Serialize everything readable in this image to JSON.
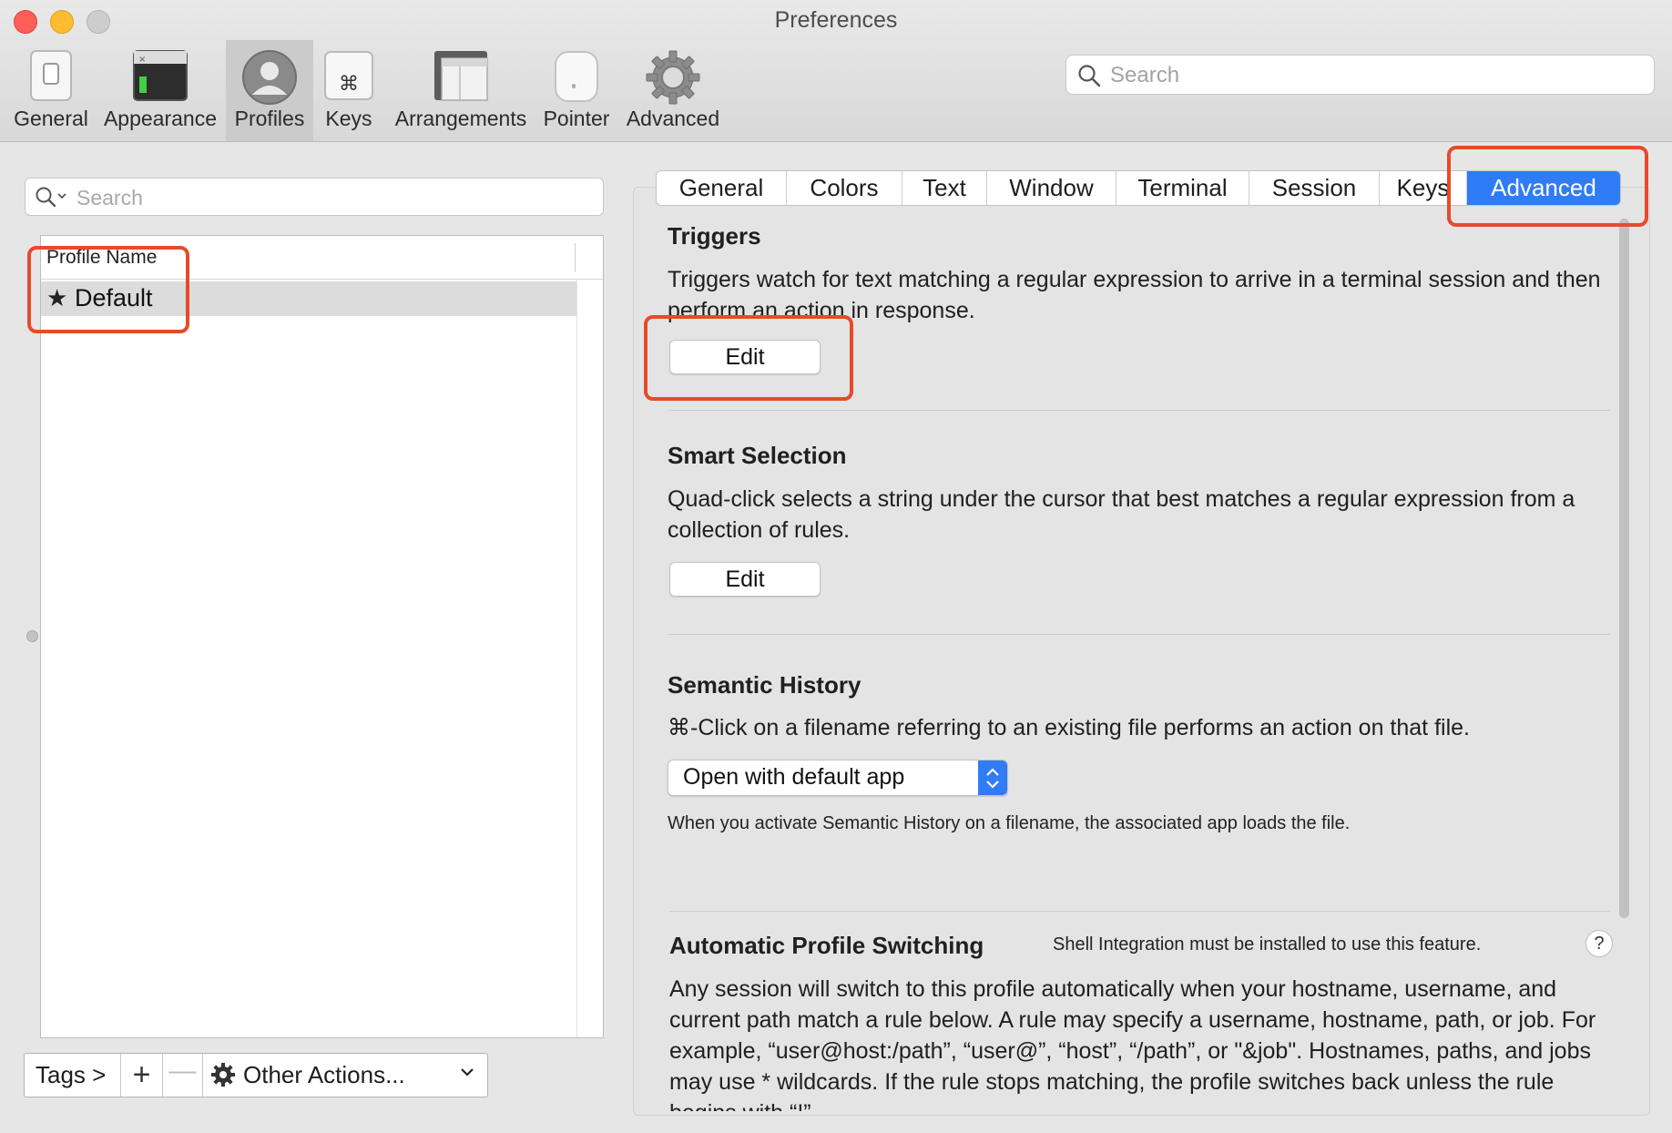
{
  "window": {
    "title": "Preferences"
  },
  "toolbar": {
    "items": [
      {
        "label": "General",
        "icon": "general-switch-icon"
      },
      {
        "label": "Appearance",
        "icon": "appearance-terminal-icon"
      },
      {
        "label": "Profiles",
        "icon": "profiles-user-icon",
        "selected": true
      },
      {
        "label": "Keys",
        "icon": "keys-command-icon"
      },
      {
        "label": "Arrangements",
        "icon": "arrangements-windows-icon"
      },
      {
        "label": "Pointer",
        "icon": "pointer-mouse-icon"
      },
      {
        "label": "Advanced",
        "icon": "advanced-gear-icon"
      }
    ],
    "search_placeholder": "Search"
  },
  "profiles": {
    "search_placeholder": "Search",
    "column_header": "Profile Name",
    "rows": [
      {
        "name": "Default",
        "default": true,
        "selected": true
      }
    ],
    "bottom_bar": {
      "tags_label": "Tags >",
      "add_label": "+",
      "remove_label": "—",
      "other_actions_label": "Other Actions..."
    }
  },
  "tabs": {
    "items": [
      "General",
      "Colors",
      "Text",
      "Window",
      "Terminal",
      "Session",
      "Keys",
      "Advanced"
    ],
    "active": "Advanced"
  },
  "advanced": {
    "triggers": {
      "title": "Triggers",
      "description": "Triggers watch for text matching a regular expression to arrive in a terminal session and then perform an action in response.",
      "edit_label": "Edit"
    },
    "smart_selection": {
      "title": "Smart Selection",
      "description": "Quad-click selects a string under the cursor that best matches a regular expression from a collection of rules.",
      "edit_label": "Edit"
    },
    "semantic_history": {
      "title": "Semantic History",
      "description": "⌘-Click on a filename referring to an existing file performs an action on that file.",
      "selected_option": "Open with default app",
      "note": "When you activate Semantic History on a filename, the associated app loads the file."
    },
    "auto_profile_switching": {
      "title": "Automatic Profile Switching",
      "note": "Shell Integration must be installed to use this feature.",
      "help_label": "?",
      "description": "Any session will switch to this profile automatically when your hostname, username, and current path match a rule below. A rule may specify a username, hostname, path, or job. For example, “user@host:/path”, “user@”, “host”, “/path”, or \"&job\". Hostnames, paths, and jobs may use * wildcards. If the rule stops matching, the profile switches back unless the rule begins with “!”."
    }
  },
  "colors": {
    "accent": "#2f7cf6",
    "highlight_box": "#e74a2b",
    "close": "#fe5f57",
    "minimize": "#febc2e",
    "zoom_inactive": "#cdcdcd"
  }
}
